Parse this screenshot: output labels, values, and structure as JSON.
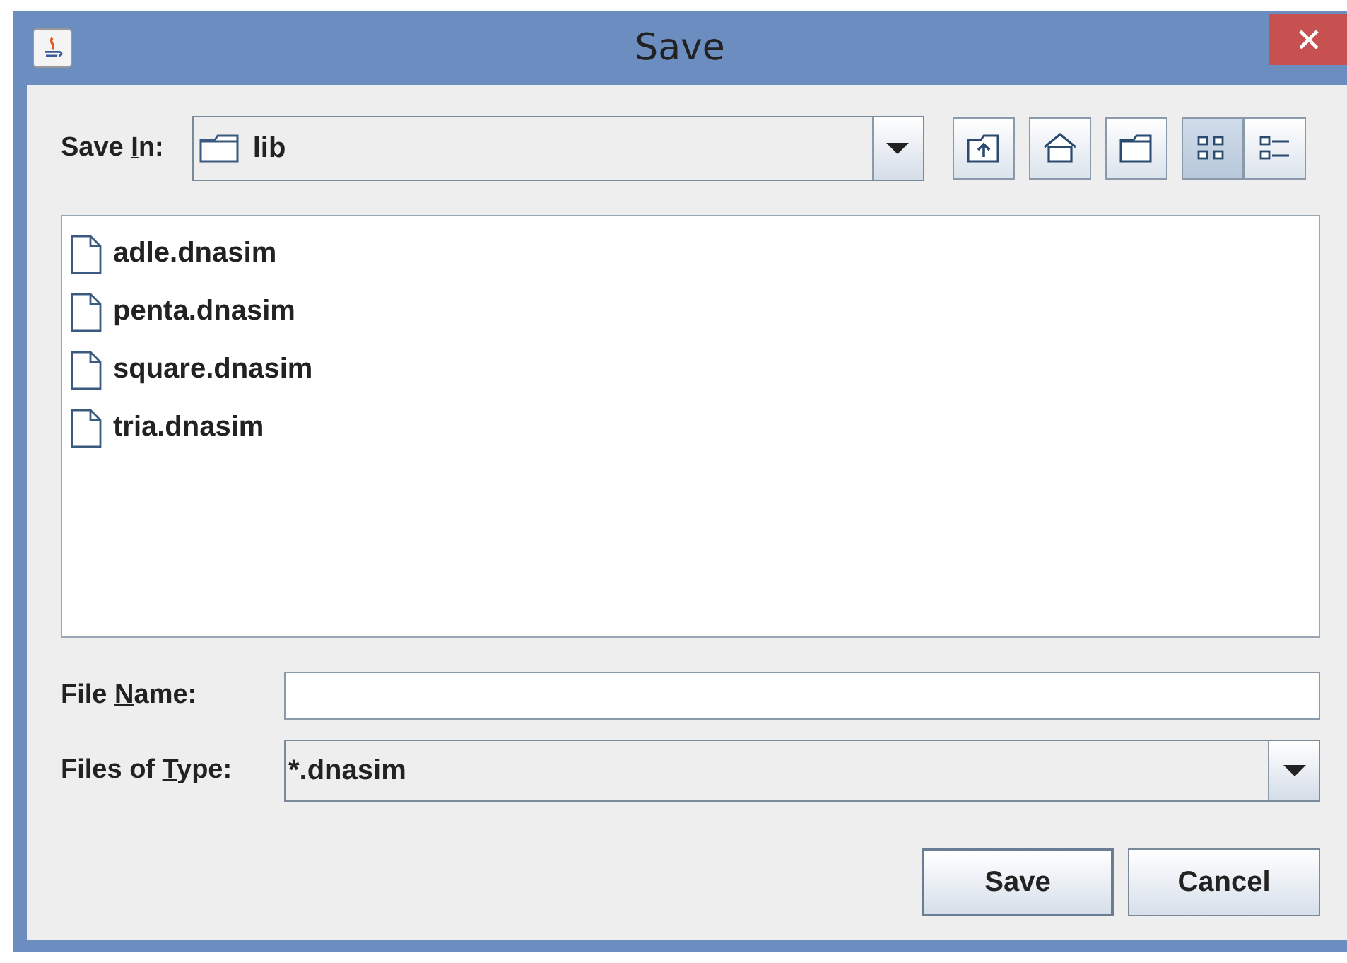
{
  "window": {
    "title": "Save"
  },
  "save_in": {
    "label_start": "Save ",
    "mnemonic": "I",
    "label_end": "n:",
    "value": "lib"
  },
  "toolbar": [
    {
      "kind": "up",
      "selected": false
    },
    {
      "kind": "home",
      "selected": false
    },
    {
      "kind": "new-folder",
      "selected": false
    },
    {
      "kind": "list",
      "selected": true
    },
    {
      "kind": "details",
      "selected": false
    }
  ],
  "files": [
    {
      "name": "adle.dnasim"
    },
    {
      "name": "penta.dnasim"
    },
    {
      "name": "square.dnasim"
    },
    {
      "name": "tria.dnasim"
    }
  ],
  "file_name": {
    "label_start": "File ",
    "mnemonic": "N",
    "label_end": "ame:"
  },
  "file_type": {
    "label_start": "Files of ",
    "mnemonic": "T",
    "label_end": "ype:",
    "value": "*.dnasim"
  },
  "buttons": [
    {
      "label": "Save",
      "kind": "default"
    },
    {
      "label": "Cancel",
      "kind": "normal"
    }
  ]
}
